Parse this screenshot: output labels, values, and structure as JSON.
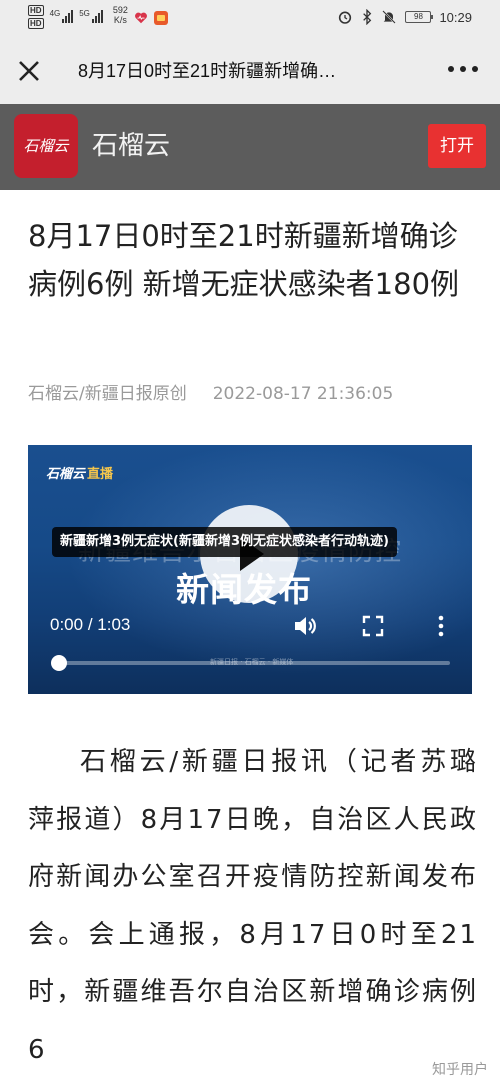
{
  "status_bar": {
    "hd1": "HD",
    "hd2": "HD",
    "sig1_label": "4G",
    "sig2_label": "5G",
    "speed_value": "592",
    "speed_unit": "K/s",
    "battery": "98",
    "time": "10:29"
  },
  "nav": {
    "title": "8月17日0时至21时新疆新增确…"
  },
  "banner": {
    "logo_text": "石榴云",
    "app_name": "石榴云",
    "open_label": "打开",
    "brand_color": "#c41f2d",
    "button_color": "#e83131"
  },
  "article": {
    "headline": "8月17日0时至21时新疆新增确诊病例6例 新增无症状感染者180例",
    "source": "石榴云/新疆日报原创",
    "date": "2022-08-17 21:36:05",
    "paragraph": "石榴云/新疆日报讯（记者苏璐萍报道）8月17日晚，自治区人民政府新闻办公室召开疫情防控新闻发布会。会上通报，8月17日0时至21时，新疆维吾尔自治区新增确诊病例6"
  },
  "video": {
    "logo_text": "石榴云",
    "logo_suffix": "直播",
    "bg_text_1": "新疆维吾尔自治区疫情防控",
    "bg_text_2": "新闻发布",
    "caption": "新疆新增3例无症状(新疆新增3例无症状感染者行动轨迹)",
    "time_current": "0:00",
    "time_separator": "/",
    "time_total": "1:03",
    "progress": 0.0,
    "footer_text": "新疆日报 · 石榴云 · 新媒体"
  },
  "watermark": "知乎用户",
  "icons": [
    "close-icon",
    "more-icon",
    "play-icon",
    "volume-icon",
    "fullscreen-icon",
    "more-vertical-icon",
    "heart-icon",
    "bluetooth-icon",
    "mute-icon",
    "alarm-icon"
  ]
}
